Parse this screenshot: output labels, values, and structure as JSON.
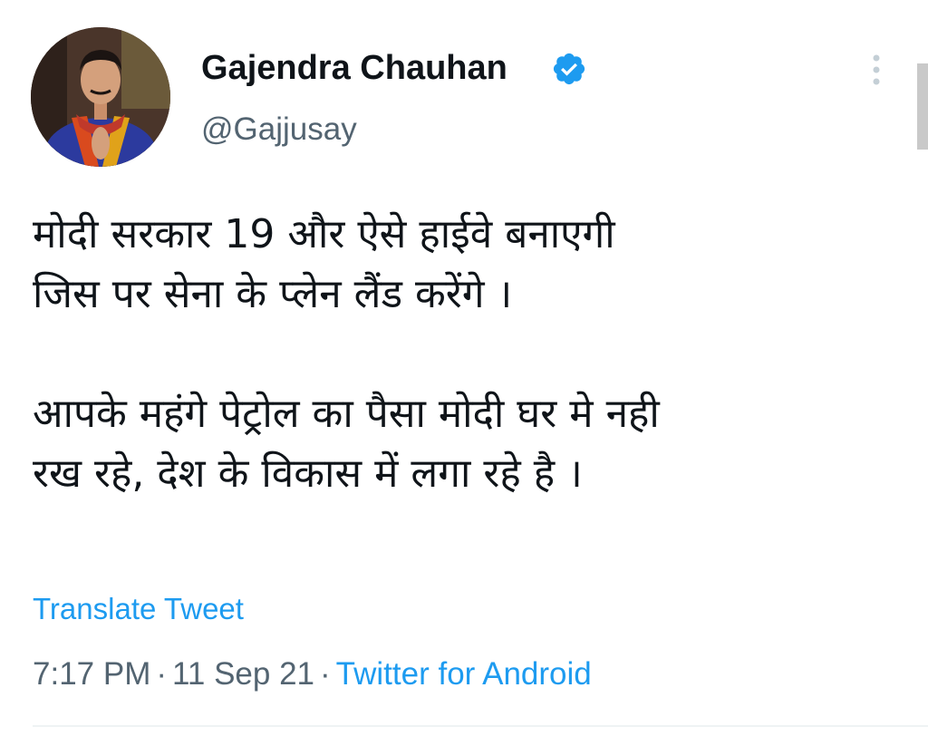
{
  "author": {
    "display_name": "Gajendra Chauhan",
    "handle": "@Gajjusay",
    "verified": true
  },
  "tweet": {
    "text": "मोदी सरकार 19 और ऐसे हाईवे बनाएगी\nजिस पर सेना के प्लेन लैंड करेंगे ।\n\nआपके महंगे पेट्रोल का पैसा मोदी घर मे नही\nरख रहे, देश के विकास में लगा रहे है ।",
    "translate_label": "Translate Tweet",
    "time": "7:17 PM",
    "date": "11 Sep 21",
    "separator": "·",
    "source": "Twitter for Android"
  },
  "colors": {
    "link": "#1d9bf0",
    "secondary_text": "#536471",
    "primary_text": "#0f1419"
  },
  "icons": {
    "verified": "verified-badge-icon",
    "more": "more-vertical-icon"
  }
}
